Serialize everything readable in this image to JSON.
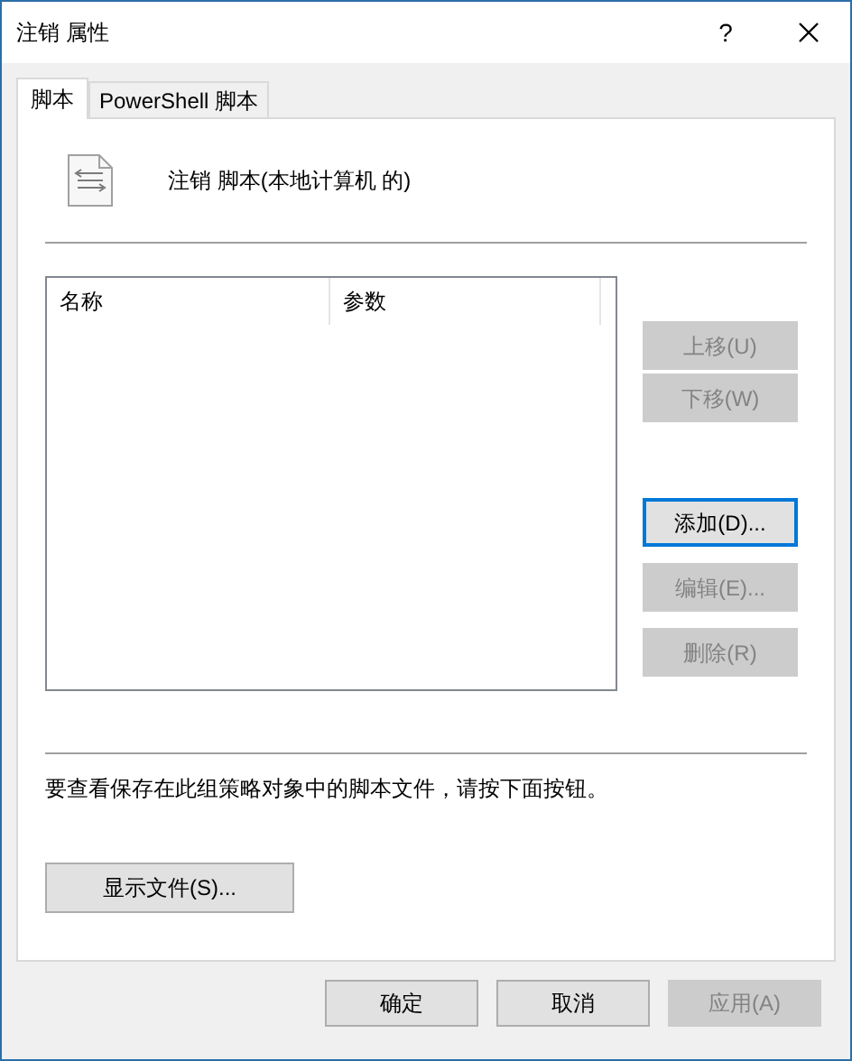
{
  "window": {
    "title": "注销 属性",
    "help": "?"
  },
  "tabs": [
    {
      "label": "脚本",
      "selected": true
    },
    {
      "label": "PowerShell 脚本",
      "selected": false
    }
  ],
  "header": {
    "title": "注销 脚本(本地计算机 的)"
  },
  "table": {
    "columns": [
      "名称",
      "参数"
    ]
  },
  "side_buttons": [
    {
      "label": "上移(U)",
      "disabled": true,
      "focused": false
    },
    {
      "label": "下移(W)",
      "disabled": true,
      "focused": false
    },
    {
      "label": "添加(D)...",
      "disabled": false,
      "focused": true
    },
    {
      "label": "编辑(E)...",
      "disabled": true,
      "focused": false
    },
    {
      "label": "删除(R)",
      "disabled": true,
      "focused": false
    }
  ],
  "hint": "要查看保存在此组策略对象中的脚本文件，请按下面按钮。",
  "show_files_button": {
    "label": "显示文件(S)..."
  },
  "footer_buttons": [
    {
      "label": "确定",
      "disabled": false
    },
    {
      "label": "取消",
      "disabled": false
    },
    {
      "label": "应用(A)",
      "disabled": true
    }
  ]
}
